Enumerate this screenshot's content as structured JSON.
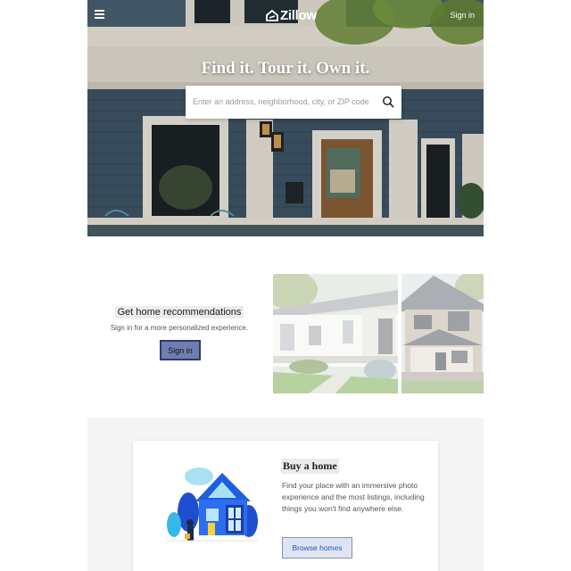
{
  "header": {
    "logo_text": "Zillow",
    "sign_in_label": "Sign in",
    "menu_icon": "hamburger-menu-icon"
  },
  "hero": {
    "title": "Find it. Tour it. Own it.",
    "search": {
      "placeholder": "Enter an address, neighborhood, city, or ZIP code",
      "icon": "search-icon"
    }
  },
  "recommendations": {
    "title": "Get home recommendations",
    "subtitle": "Sign in for a more personalized experience.",
    "button_label": "Sign in"
  },
  "buy": {
    "title": "Buy a home",
    "description": "Find your place with an immersive photo experience and the most listings, including things you won't find anywhere else.",
    "button_label": "Browse homes"
  },
  "colors": {
    "brand_blue": "#006aff",
    "siding": "#3e5466",
    "section_bg": "#f4f4f5"
  }
}
